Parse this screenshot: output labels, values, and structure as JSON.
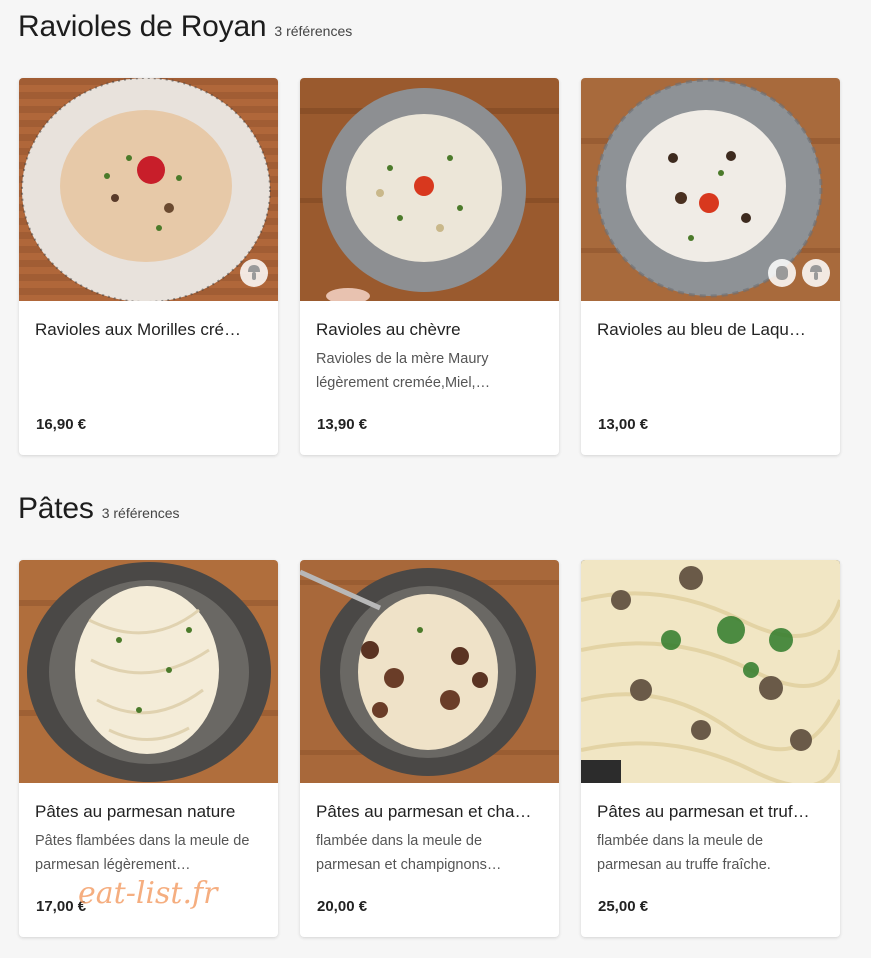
{
  "sections": [
    {
      "title": "Ravioles de Royan",
      "count": "3 références",
      "items": [
        {
          "title": "Ravioles aux Morilles cré…",
          "description": "",
          "price": "16,90 €",
          "badges": [
            "mushroom-icon"
          ]
        },
        {
          "title": "Ravioles au chèvre",
          "description": "Ravioles de la mère Maury légèrement cremée,Miel,…",
          "price": "13,90 €",
          "badges": []
        },
        {
          "title": "Ravioles au bleu de Laqu…",
          "description": "",
          "price": "13,00 €",
          "badges": [
            "cheese-icon",
            "mushroom-icon"
          ]
        }
      ]
    },
    {
      "title": "Pâtes",
      "count": "3 références",
      "items": [
        {
          "title": "Pâtes au parmesan nature",
          "description": "Pâtes flambées dans la meule de parmesan légèrement…",
          "price": "17,00 €",
          "badges": []
        },
        {
          "title": "Pâtes au parmesan et cha…",
          "description": "flambée dans la meule de parmesan et champignons…",
          "price": "20,00 €",
          "badges": []
        },
        {
          "title": "Pâtes au parmesan et truf…",
          "description": "flambée dans la meule de parmesan au truffe fraîche.",
          "price": "25,00 €",
          "badges": []
        }
      ]
    }
  ],
  "watermark": "eat-list.fr",
  "colors": {
    "background": "#f6f6f6",
    "card": "#ffffff",
    "watermark": "#f4a06a",
    "wood": "#a8673a"
  }
}
